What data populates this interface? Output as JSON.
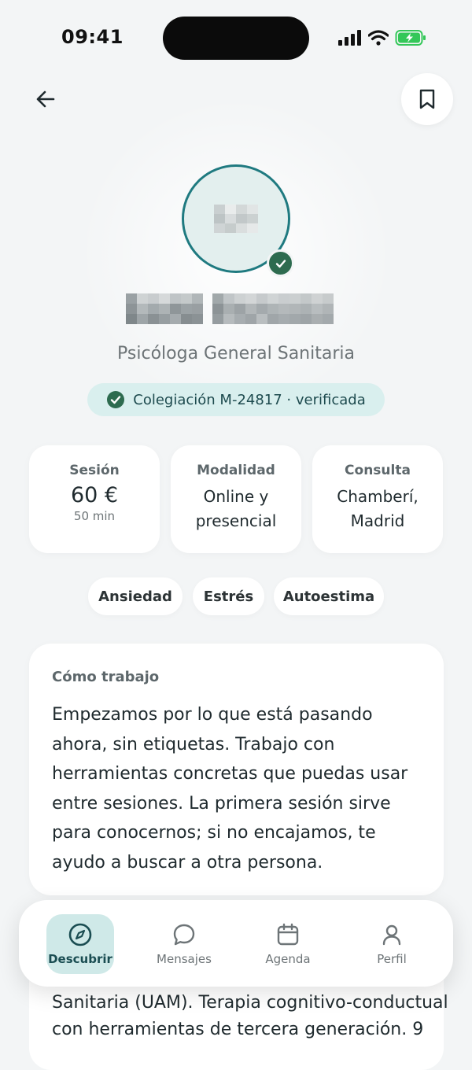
{
  "status_bar": {
    "time": "09:41"
  },
  "profile": {
    "role": "Psicóloga General Sanitaria",
    "credential": "Colegiación M-24817 · verificada"
  },
  "info_cards": [
    {
      "label": "Sesión",
      "value": "60 €",
      "sub": "50 min"
    },
    {
      "label": "Modalidad",
      "value_line1": "Online y",
      "value_line2": "presencial"
    },
    {
      "label": "Consulta",
      "value_line1": "Chamberí,",
      "value_line2": "Madrid"
    }
  ],
  "tags": [
    "Ansiedad",
    "Estrés",
    "Autoestima"
  ],
  "about": {
    "title": "Cómo trabajo",
    "lines": [
      "Empezamos por lo que está pasando",
      "ahora, sin etiquetas. Trabajo con",
      "herramientas concretas que puedas usar",
      "entre sesiones. La primera sesión sirve",
      "para conocernos; si no encajamos, te",
      "ayudo a buscar a otra persona."
    ]
  },
  "background_card": {
    "lines": [
      "Sanitaria (UAM). Terapia cognitivo-conductual",
      "con herramientas de tercera generación. 9"
    ]
  },
  "tab_bar": {
    "tabs": [
      {
        "label": "Descubrir",
        "icon": "compass-icon",
        "active": true
      },
      {
        "label": "Mensajes",
        "icon": "chat-bubble-icon",
        "active": false
      },
      {
        "label": "Agenda",
        "icon": "calendar-icon",
        "active": false
      },
      {
        "label": "Perfil",
        "icon": "person-icon",
        "active": false
      }
    ]
  },
  "colors": {
    "accent": "#1f7a80",
    "verified": "#2d6b4f",
    "badge_bg": "#d9efee",
    "background": "#f3f5f6"
  }
}
